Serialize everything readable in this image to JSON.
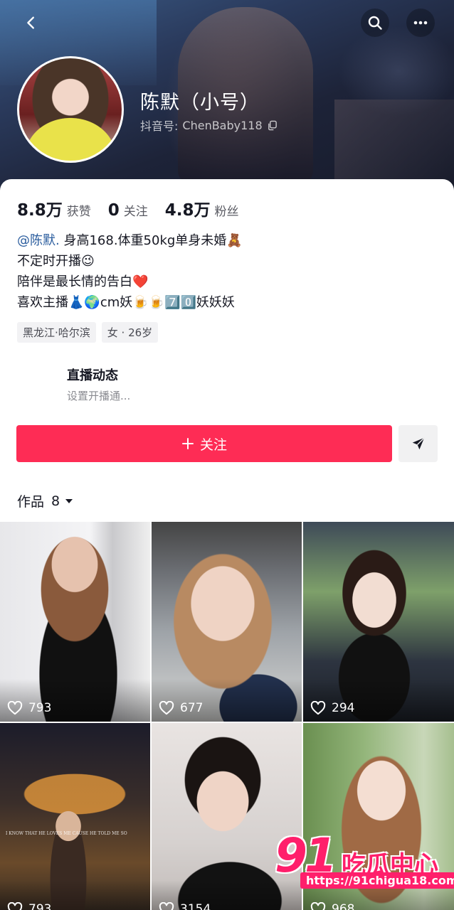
{
  "header": {
    "back_icon": "chevron-left-icon",
    "search_icon": "search-icon",
    "more_icon": "more-horizontal-icon"
  },
  "profile": {
    "name": "陈默（小号）",
    "douyin_id_label": "抖音号:",
    "douyin_id": "ChenBaby118",
    "copy_icon": "copy-icon"
  },
  "stats": [
    {
      "value": "8.8万",
      "label": "获赞"
    },
    {
      "value": "0",
      "label": "关注"
    },
    {
      "value": "4.8万",
      "label": "粉丝"
    }
  ],
  "bio": {
    "mention": "@陈默.",
    "line1_rest": "身高168.体重50kg单身未婚🧸",
    "line2": "不定时开播😉",
    "line3": "陪伴是最长情的告白❤️",
    "line4": "喜欢主播👗🌍cm妖🍺🍺7️⃣0️⃣妖妖妖"
  },
  "tags": [
    "黑龙江·哈尔滨",
    "女 · 26岁"
  ],
  "live": {
    "title": "直播动态",
    "subtitle": "设置开播通..."
  },
  "actions": {
    "follow_label": "关注",
    "follow_icon": "plus-icon",
    "share_icon": "send-icon"
  },
  "works": {
    "tab_label": "作品",
    "count": "8",
    "dropdown_icon": "caret-down-icon"
  },
  "videos": [
    {
      "likes": "793"
    },
    {
      "likes": "677"
    },
    {
      "likes": "294"
    },
    {
      "likes": "793"
    },
    {
      "likes": "3154"
    },
    {
      "likes": "968"
    }
  ],
  "video_overlay_text": "I KNOW THAT HE LOVES ME CAUSE HE TOLD ME SO",
  "watermark": {
    "number": "91",
    "text": "吃瓜中心",
    "url": "https://91chigua18.com"
  },
  "colors": {
    "accent": "#fe2c55",
    "mention": "#2b5d9e",
    "watermark": "#ff1f6b"
  }
}
